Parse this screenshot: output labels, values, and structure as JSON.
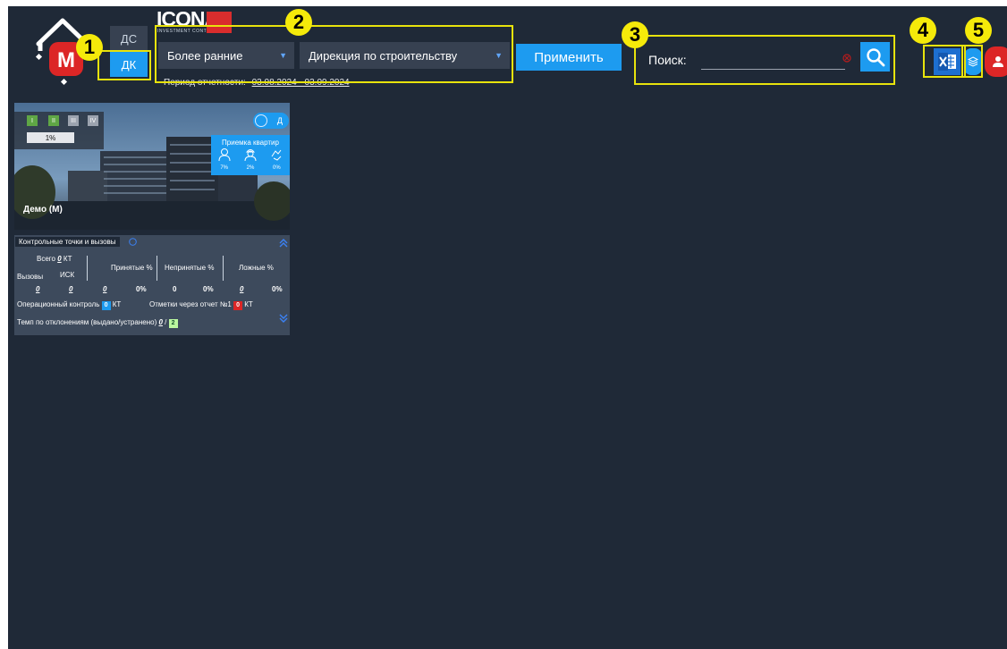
{
  "header": {
    "toggle": {
      "ds": "ДС",
      "dk": "ДК"
    },
    "brand": {
      "name": "ICONA",
      "tagline": "INVESTMENT CONTROL"
    },
    "period_select": "Более ранние",
    "direction_select": "Дирекция по строительству",
    "apply_label": "Применить",
    "period_label": "Период отчетности:",
    "period_value": "03.08.2024 - 03.09.2024"
  },
  "search": {
    "label": "Поиск:",
    "value": ""
  },
  "annotations": [
    "1",
    "2",
    "3",
    "4",
    "5"
  ],
  "card": {
    "name": "Демо (М)",
    "phases": [
      "I",
      "II",
      "III",
      "IV"
    ],
    "progress": "1%",
    "toggle_label": "Д",
    "acceptance_title": "Приемка квартир",
    "acceptance_values": [
      "7%",
      "2%",
      "0%"
    ]
  },
  "control": {
    "title": "Контрольные точки и вызовы",
    "total_label": "Всего",
    "total_value": "0",
    "kt": "КТ",
    "calls_label": "Вызовы",
    "isk_label": "ИСК",
    "accepted_label": "Принятые %",
    "not_accepted_label": "Непринятые %",
    "false_label": "Ложные %",
    "row": [
      "0",
      "0",
      "0",
      "0%",
      "0",
      "0%",
      "0",
      "0%"
    ],
    "operational_label": "Операционный контроль",
    "operational_value": "0",
    "report_label": "Отметки через отчет №1",
    "report_value": "0",
    "tempo_label": "Темп по отклонениям (выдано/устранено)",
    "tempo_issued": "0",
    "tempo_sep": "/",
    "tempo_fixed": "2"
  },
  "colors": {
    "background": "#1f2937",
    "accent": "#1d9bf0",
    "annotation": "#f5ea0a",
    "danger": "#dc2626"
  }
}
